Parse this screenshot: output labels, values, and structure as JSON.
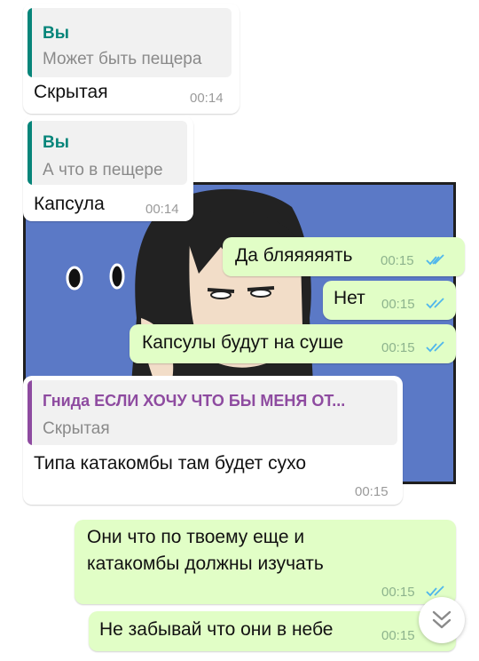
{
  "messages": [
    {
      "reply": {
        "sender": "Вы",
        "text": "Может быть пещера"
      },
      "text": "Скрытая",
      "time": "00:14"
    },
    {
      "reply": {
        "sender": "Вы",
        "text": "А что в пещере"
      },
      "text": "Капсула",
      "time": "00:14"
    },
    {
      "text": "Да бляяяяять",
      "time": "00:15"
    },
    {
      "text": "Нет",
      "time": "00:15"
    },
    {
      "text": "Капсулы будут на суше",
      "time": "00:15"
    },
    {
      "reply": {
        "sender": "Гнида ЕСЛИ ХОЧУ ЧТО БЫ МЕНЯ ОТ...",
        "text": "Скрытая"
      },
      "text": "Типа катакомбы там будет сухо",
      "time": "00:15"
    },
    {
      "text": "Они что по твоему еще и катакомбы должны изучать",
      "time": "00:15"
    },
    {
      "text": "Не забывай что они в небе",
      "time": "00:15"
    }
  ],
  "colors": {
    "outgoing_bubble": "#e1fec6",
    "incoming_bubble": "#ffffff",
    "quote_self": "#07857a",
    "quote_other": "#8e4ba0",
    "read_ticks": "#4fb6ec"
  },
  "icons": {
    "read": "double-check-icon",
    "scroll": "double-chevron-down-icon"
  }
}
